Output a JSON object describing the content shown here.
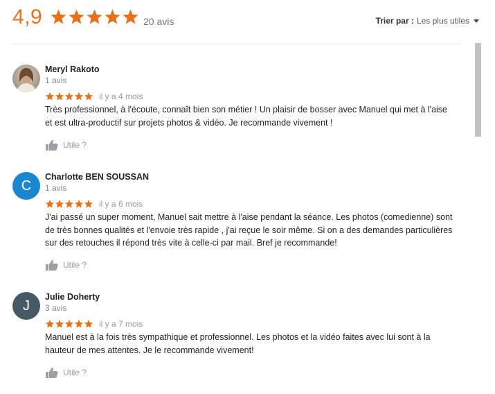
{
  "summary": {
    "rating": "4,9",
    "stars": 5,
    "count_label": "20 avis",
    "star_color": "#e7711b"
  },
  "sort": {
    "label": "Trier par :",
    "value": "Les plus utiles"
  },
  "reviews": [
    {
      "name": "Meryl Rakoto",
      "subcount": "1 avis",
      "avatar_type": "photo",
      "stars": 5,
      "date": "il y a 4 mois",
      "text": "Très professionnel, à l'écoute, connaît bien son métier ! Un plaisir de bosser avec Manuel qui met à l'aise et est ultra-productif sur projets photos & vidéo. Je recommande vivement !",
      "helpful_label": "Utile ?"
    },
    {
      "name": "Charlotte BEN SOUSSAN",
      "subcount": "1 avis",
      "avatar_type": "letter",
      "avatar_letter": "C",
      "avatar_color": "#1a86d0",
      "stars": 5,
      "date": "il y a 6 mois",
      "text": "J'ai passé un super moment, Manuel sait mettre à l'aise pendant la séance. Les photos (comedienne) sont de très bonnes qualités et l'envoie très rapide , j'ai reçue le soir même. Si on a des demandes particulières sur des retouches il répond très vite à celle-ci par mail. Bref je recommande!",
      "helpful_label": "Utile ?"
    },
    {
      "name": "Julie Doherty",
      "subcount": "3 avis",
      "avatar_type": "letter",
      "avatar_letter": "J",
      "avatar_color": "#455a64",
      "stars": 5,
      "date": "il y a 7 mois",
      "text": "Manuel est à la fois très sympathique et professionnel. Les photos et la vidéo faites avec lui sont à la hauteur de mes attentes. Je le recommande vivement!",
      "helpful_label": "Utile ?"
    }
  ]
}
